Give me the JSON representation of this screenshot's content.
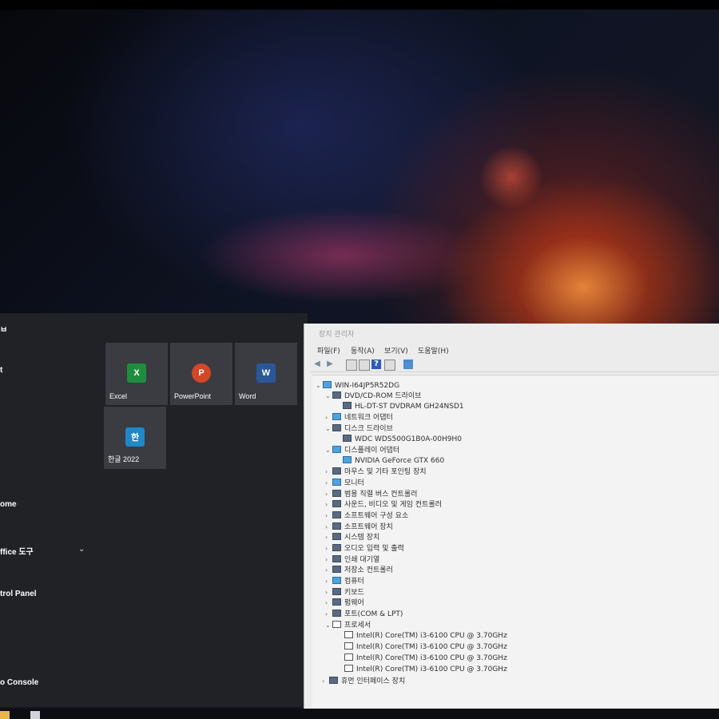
{
  "start_menu": {
    "left_items": [
      {
        "label": "ㅂ"
      },
      {
        "label": "t"
      },
      {
        "label": "ome"
      },
      {
        "label": "ffice 도구"
      },
      {
        "label": "trol Panel"
      },
      {
        "label": "o Console"
      }
    ],
    "tiles": [
      {
        "label": "Excel",
        "icon": "excel-icon",
        "color": "#1e8e3e",
        "glyph": "X"
      },
      {
        "label": "PowerPoint",
        "icon": "powerpoint-icon",
        "color": "#d24726",
        "glyph": "P"
      },
      {
        "label": "Word",
        "icon": "word-icon",
        "color": "#2b5797",
        "glyph": "W"
      },
      {
        "label": "한글 2022",
        "icon": "hangul-icon",
        "color": "#1e88c8",
        "glyph": "한"
      }
    ]
  },
  "device_manager": {
    "title": "장치 관리자",
    "menu": [
      "파일(F)",
      "동작(A)",
      "보기(V)",
      "도움말(H)"
    ],
    "tree": [
      {
        "text": "WIN-I64JP5R52DG",
        "exp": "⌄"
      },
      {
        "text": "DVD/CD-ROM 드라이브",
        "exp": "⌄"
      },
      {
        "text": "HL-DT-ST DVDRAM GH24NSD1",
        "exp": ""
      },
      {
        "text": "네트워크 어댑터",
        "exp": "›"
      },
      {
        "text": "디스크 드라이브",
        "exp": "⌄"
      },
      {
        "text": "WDC WDS500G1B0A-00H9H0",
        "exp": ""
      },
      {
        "text": "디스플레이 어댑터",
        "exp": "⌄"
      },
      {
        "text": "NVIDIA GeForce GTX 660",
        "exp": ""
      },
      {
        "text": "마우스 및 기타 포인팅 장치",
        "exp": "›"
      },
      {
        "text": "모니터",
        "exp": "›"
      },
      {
        "text": "범용 직렬 버스 컨트롤러",
        "exp": "›"
      },
      {
        "text": "사운드, 비디오 및 게임 컨트롤러",
        "exp": "›"
      },
      {
        "text": "소프트웨어 구성 요소",
        "exp": "›"
      },
      {
        "text": "소프트웨어 장치",
        "exp": "›"
      },
      {
        "text": "시스템 장치",
        "exp": "›"
      },
      {
        "text": "오디오 입력 및 출력",
        "exp": "›"
      },
      {
        "text": "인쇄 대기열",
        "exp": "›"
      },
      {
        "text": "저장소 컨트롤러",
        "exp": "›"
      },
      {
        "text": "컴퓨터",
        "exp": "›"
      },
      {
        "text": "키보드",
        "exp": "›"
      },
      {
        "text": "펌웨어",
        "exp": "›"
      },
      {
        "text": "포트(COM & LPT)",
        "exp": "›"
      },
      {
        "text": "프로세서",
        "exp": "⌄"
      },
      {
        "text": "Intel(R) Core(TM) i3-6100 CPU @ 3.70GHz",
        "exp": ""
      },
      {
        "text": "Intel(R) Core(TM) i3-6100 CPU @ 3.70GHz",
        "exp": ""
      },
      {
        "text": "Intel(R) Core(TM) i3-6100 CPU @ 3.70GHz",
        "exp": ""
      },
      {
        "text": "Intel(R) Core(TM) i3-6100 CPU @ 3.70GHz",
        "exp": ""
      },
      {
        "text": "휴먼 인터페이스 장치",
        "exp": "›"
      }
    ]
  }
}
